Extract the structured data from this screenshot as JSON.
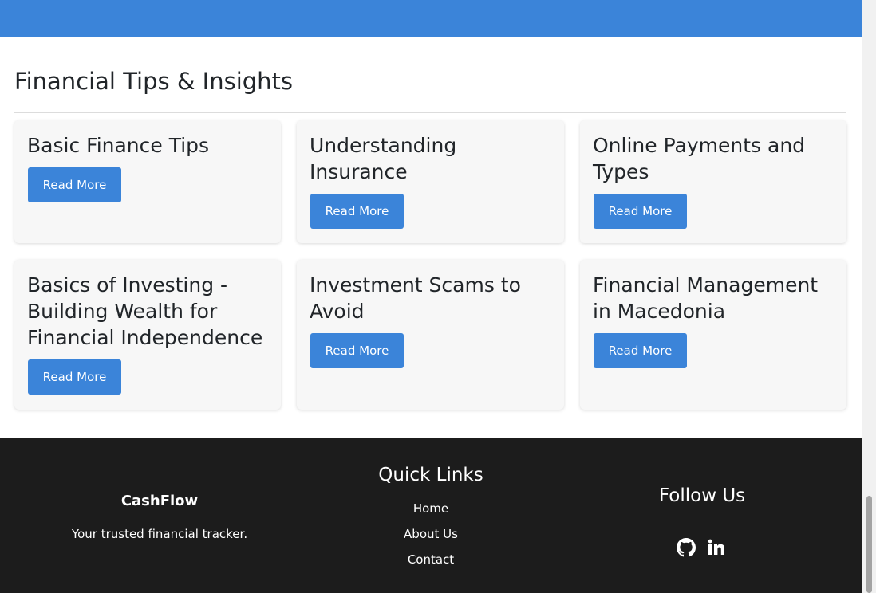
{
  "section": {
    "title": "Financial Tips & Insights"
  },
  "cards": [
    {
      "title": "Basic Finance Tips",
      "button": "Read More"
    },
    {
      "title": "Understanding Insurance",
      "button": "Read More"
    },
    {
      "title": "Online Payments and Types",
      "button": "Read More"
    },
    {
      "title": "Basics of Investing - Building Wealth for Financial Independence",
      "button": "Read More"
    },
    {
      "title": "Investment Scams to Avoid",
      "button": "Read More"
    },
    {
      "title": "Financial Management in Macedonia",
      "button": "Read More"
    }
  ],
  "footer": {
    "brand": "CashFlow",
    "tagline": "Your trusted financial tracker.",
    "quick_links_title": "Quick Links",
    "links": [
      "Home",
      "About Us",
      "Contact"
    ],
    "follow_title": "Follow Us",
    "social": [
      "github-icon",
      "linkedin-icon"
    ]
  },
  "colors": {
    "accent": "#3b84d9",
    "footer_bg": "#1c1c1c",
    "card_bg": "#f7f7f7"
  }
}
